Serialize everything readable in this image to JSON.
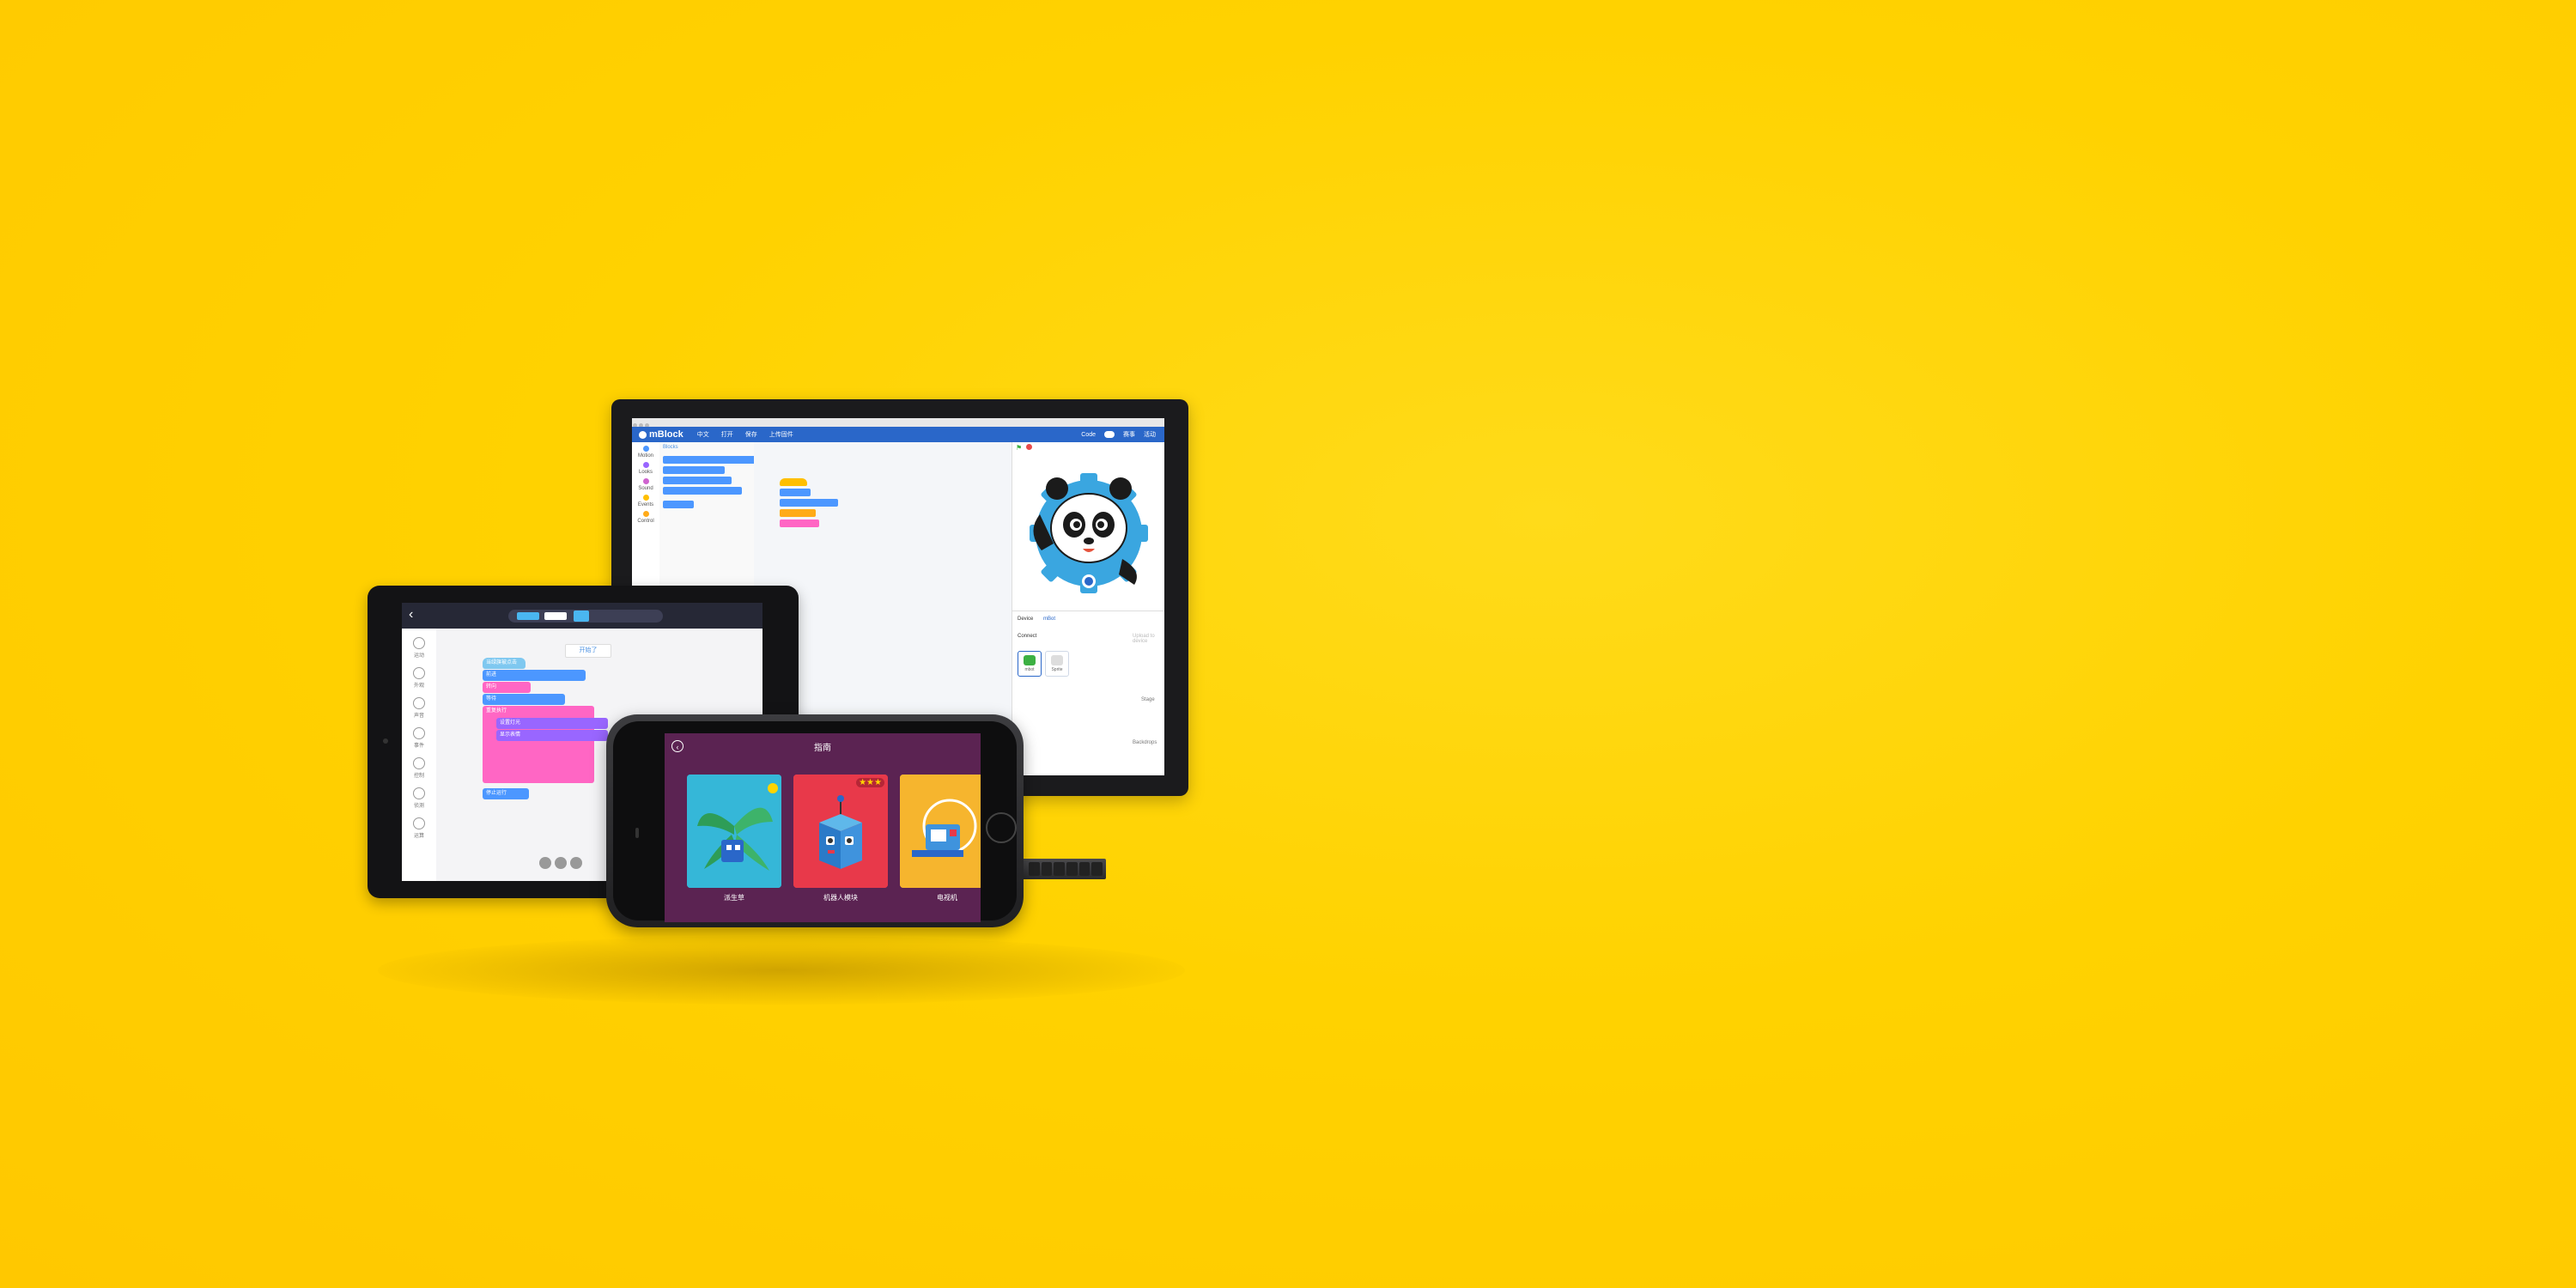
{
  "monitor": {
    "app_name": "mBlock",
    "menu": [
      "中文",
      "打开",
      "保存",
      "上传固件"
    ],
    "mode_label": "Code",
    "right_links": [
      "赛事",
      "活动"
    ],
    "palette_title": "Blocks",
    "categories": [
      "Motion",
      "Looks",
      "Sound",
      "Events",
      "Control"
    ],
    "device_label": "Device",
    "device_value": "mBot",
    "connect_label": "Connect",
    "upload_label": "Upload to device",
    "devices": [
      "mbot",
      "Sprite"
    ],
    "stage_panel": [
      "Stage",
      "Backdrops"
    ],
    "colors": {
      "menubar": "#2a67c9",
      "block_blue": "#4c97ff",
      "block_yellow": "#ffbf00",
      "block_pink": "#ff66c4"
    }
  },
  "tablet": {
    "label_box": "开始了",
    "side_items": [
      "运动",
      "外观",
      "声音",
      "事件",
      "控制",
      "侦测",
      "运算"
    ],
    "blocks": [
      "当绿旗被点击",
      "前进",
      "转向",
      "等待",
      "重复执行",
      "设置灯光",
      "显示表情",
      "停止运行"
    ]
  },
  "phone": {
    "back_icon": "chevron-left-icon",
    "title": "指南",
    "cards": [
      {
        "label": "派生草",
        "stars": "★",
        "color": "#35b7d8"
      },
      {
        "label": "机器人模块",
        "stars": "★★★",
        "color": "#e8394a"
      },
      {
        "label": "电视机",
        "stars": "★",
        "color": "#f6b52e"
      }
    ]
  }
}
